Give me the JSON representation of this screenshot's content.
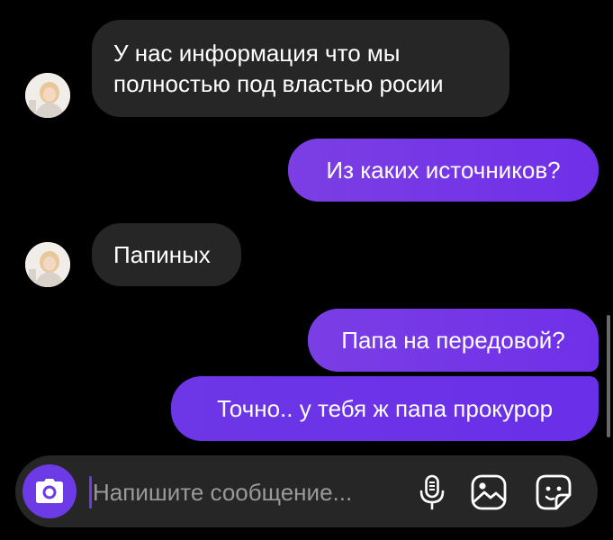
{
  "messages": [
    {
      "direction": "incoming",
      "lines": [
        "У нас информация что мы",
        "полностью под властью росии"
      ]
    },
    {
      "direction": "outgoing",
      "text": "Из каких источников?"
    },
    {
      "direction": "incoming",
      "lines": [
        "Папиных"
      ]
    },
    {
      "direction": "outgoing",
      "text": "Папа на передовой?"
    },
    {
      "direction": "outgoing",
      "text": "Точно.. у тебя ж папа прокурор"
    }
  ],
  "composer": {
    "placeholder": "Напишите сообщение...",
    "icons": [
      "camera-icon",
      "microphone-icon",
      "gallery-icon",
      "sticker-icon"
    ]
  },
  "colors": {
    "background": "#000000",
    "incoming_bubble": "#262626",
    "outgoing_gradient_start": "#7b3fe4",
    "outgoing_gradient_end": "#6f2fe8",
    "accent": "#6c3be6",
    "text": "#ffffff",
    "placeholder": "#9a9a9a"
  }
}
